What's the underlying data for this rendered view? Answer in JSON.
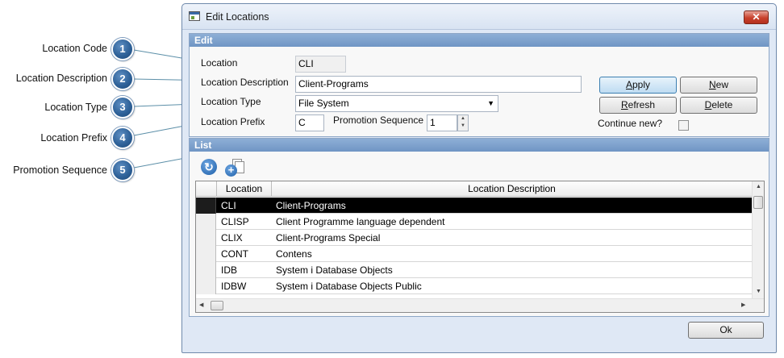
{
  "callouts": [
    {
      "number": "1",
      "label": "Location Code"
    },
    {
      "number": "2",
      "label": "Location Description"
    },
    {
      "number": "3",
      "label": "Location Type"
    },
    {
      "number": "4",
      "label": "Location Prefix"
    },
    {
      "number": "5",
      "label": "Promotion Sequence"
    }
  ],
  "window": {
    "title": "Edit Locations",
    "close_label": "✕"
  },
  "edit": {
    "header": "Edit",
    "location_label": "Location",
    "location_value": "CLI",
    "description_label": "Location Description",
    "description_value": "Client-Programs",
    "type_label": "Location Type",
    "type_value": "File System",
    "prefix_label": "Location Prefix",
    "prefix_value": "C",
    "promotion_label": "Promotion Sequence",
    "promotion_value": "1",
    "continue_label": "Continue new?",
    "continue_checked": false
  },
  "buttons": {
    "apply_pre": "",
    "apply_key": "A",
    "apply_post": "pply",
    "new_pre": "",
    "new_key": "N",
    "new_post": "ew",
    "refresh_pre": "",
    "refresh_key": "R",
    "refresh_post": "efresh",
    "delete_pre": "",
    "delete_key": "D",
    "delete_post": "elete",
    "ok": "Ok"
  },
  "list": {
    "header": "List",
    "columns": [
      "Location",
      "Location Description"
    ],
    "rows": [
      {
        "code": "CLI",
        "description": "Client-Programs",
        "selected": true
      },
      {
        "code": "CLISP",
        "description": "Client Programme language dependent",
        "selected": false
      },
      {
        "code": "CLIX",
        "description": "Client-Programs Special",
        "selected": false
      },
      {
        "code": "CONT",
        "description": "Contens",
        "selected": false
      },
      {
        "code": "IDB",
        "description": "System i Database Objects",
        "selected": false
      },
      {
        "code": "IDBW",
        "description": "System i Database Objects Public",
        "selected": false
      }
    ]
  },
  "icons": {
    "refresh": "refresh-icon",
    "copy_add": "copy-add-icon",
    "dropdown": "chevron-down-icon"
  },
  "colors": {
    "callout_badge": "#2f6299",
    "panel_header": "#7aa0cc",
    "close_button": "#c8412d",
    "selected_row": "#000000"
  }
}
